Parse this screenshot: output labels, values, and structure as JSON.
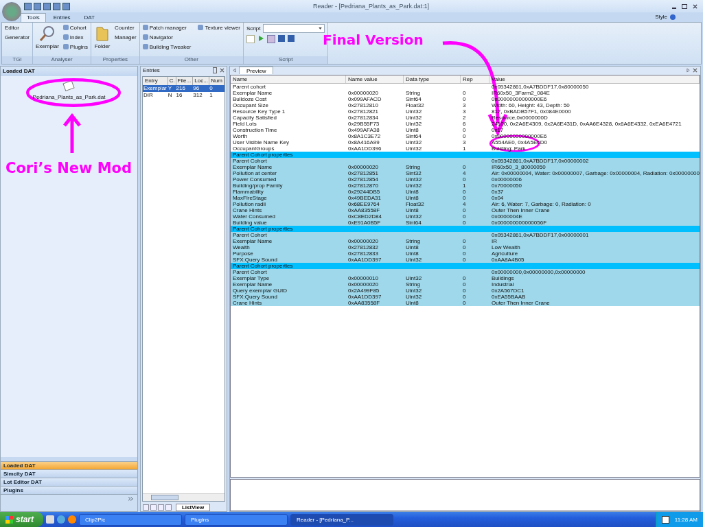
{
  "window": {
    "title": "Reader - [Pedriana_Plants_as_Park.dat:1]"
  },
  "ribbon": {
    "tabs": [
      {
        "label": "Tools",
        "selected": true
      },
      {
        "label": "Entries",
        "selected": false
      },
      {
        "label": "DAT",
        "selected": false
      }
    ],
    "style_menu": "Style",
    "groups": [
      {
        "label": "TGI",
        "items": [
          "Editor",
          "Generator"
        ]
      },
      {
        "label": "Analyser",
        "big": "Exemplar",
        "items": [
          "Cohort",
          "Index",
          "Plugins"
        ]
      },
      {
        "label": "Properties",
        "big": "Folder",
        "items": [
          "Counter",
          "Manager"
        ]
      },
      {
        "label": "Other",
        "items": [
          "Patch manager",
          "Navigator",
          "Building Tweaker",
          "Texture viewer"
        ]
      }
    ],
    "script": {
      "label": "Script",
      "group_label": "Script"
    }
  },
  "left_panel": {
    "title": "Loaded DAT",
    "file": "Pedriana_Plants_as_Park.dat",
    "nav": [
      {
        "label": "Loaded DAT",
        "selected": true
      },
      {
        "label": "Simcity DAT",
        "selected": false
      },
      {
        "label": "Lot Editor DAT",
        "selected": false
      },
      {
        "label": "Plugins",
        "selected": false
      }
    ]
  },
  "entries": {
    "title": "Entries",
    "columns": [
      "Entry",
      "C.",
      "File...",
      "Loc...",
      "Num"
    ],
    "rows": [
      {
        "cells": [
          "Exemplar",
          "Y",
          "216",
          "96",
          "0"
        ],
        "selected": true
      },
      {
        "cells": [
          "DIR",
          "N",
          "16",
          "312",
          "1"
        ],
        "selected": false
      }
    ],
    "tab": "ListView"
  },
  "preview": {
    "tab": "Preview",
    "columns": [
      "Name",
      "Name value",
      "Data type",
      "Rep",
      "Value"
    ],
    "groups": [
      {
        "highlighted": false,
        "rows": [
          [
            "Parent cohort",
            "",
            "",
            "",
            "0x05342861,0xA7BDDF17,0x80000050"
          ],
          [
            "Exemplar Name",
            "0x00000020",
            "String",
            "0",
            "IR60x50_3Farm2_084E"
          ],
          [
            "Bulldoze Cost",
            "0x099AFACD",
            "Sint64",
            "0",
            "0x00000000000000E6"
          ],
          [
            "Occupant Size",
            "0x27812810",
            "Float32",
            "3",
            "Width: 60, Height: 43, Depth: 50"
          ],
          [
            "Resource Key Type 1",
            "0x27812821",
            "Uint32",
            "3",
            "817, 0xBADB57F1, 0x084E0000"
          ],
          [
            "Capacity Satisfied",
            "0x27812834",
            "Uint32",
            "2",
            "Resource,0x0000000D"
          ],
          [
            "Field Lots",
            "0x29B55F73",
            "Uint32",
            "6",
            "24100, 0x2A6E4309, 0x2A6E431D, 0xAA6E4328, 0x6A6E4332, 0xEA6E4721"
          ],
          [
            "Construction Time",
            "0x499AFA38",
            "Uint8",
            "0",
            "0x17"
          ],
          [
            "Worth",
            "0x8A1C3E72",
            "Sint64",
            "0",
            "0x00000000000000E6"
          ],
          [
            "User Visible Name Key",
            "0x8A416A99",
            "Uint32",
            "3",
            "A554AE0, 0x4A5E6D0"
          ],
          [
            "OccupantGroups",
            "0xAA1DD396",
            "Uint32",
            "1",
            "Building: Park"
          ]
        ]
      },
      {
        "header": "Parent Cohort properties",
        "highlighted": true,
        "rows": [
          [
            "Parent Cohort",
            "",
            "",
            "",
            "0x05342861,0xA7BDDF17,0x00000002"
          ],
          [
            "Exemplar Name",
            "0x00000020",
            "String",
            "0",
            "IR60x50_3_80000050"
          ],
          [
            "Pollution at center",
            "0x27812851",
            "Sint32",
            "4",
            "Air: 0x00000004, Water: 0x00000007, Garbage: 0x00000004, Radiation: 0x00000000"
          ],
          [
            "Power Consumed",
            "0x27812854",
            "Uint32",
            "0",
            "0x00000006"
          ],
          [
            "Building/prop Family",
            "0x27812870",
            "Uint32",
            "1",
            "0x70000050"
          ],
          [
            "Flammability",
            "0x29244DB5",
            "Uint8",
            "0",
            "0x37"
          ],
          [
            "MaxFireStage",
            "0x49BEDA31",
            "Uint8",
            "0",
            "0x04"
          ],
          [
            "Pollution radii",
            "0x68EE9764",
            "Float32",
            "4",
            "Air: 6, Water: 7, Garbage: 0, Radiation: 0"
          ],
          [
            "Crane Hints",
            "0xAA83558F",
            "Uint8",
            "0",
            "Outer Then Inner Crane"
          ],
          [
            "Water Consumed",
            "0xC8ED2D84",
            "Uint32",
            "0",
            "0x0000004E"
          ],
          [
            "Building value",
            "0xE91A0B5F",
            "Sint64",
            "0",
            "0x000000000000056F"
          ]
        ]
      },
      {
        "header": "Parent Cohort properties",
        "highlighted": true,
        "rows": [
          [
            "Parent Cohort",
            "",
            "",
            "",
            "0x05342861,0xA7BDDF17,0x00000001"
          ],
          [
            "Exemplar Name",
            "0x00000020",
            "String",
            "0",
            "IR"
          ],
          [
            "Wealth",
            "0x27812832",
            "Uint8",
            "0",
            "Low Wealth"
          ],
          [
            "Purpose",
            "0x27812833",
            "Uint8",
            "0",
            "Agriculture"
          ],
          [
            "SFX:Query Sound",
            "0xAA1DD397",
            "Uint32",
            "0",
            "0xAA8A4B05"
          ]
        ]
      },
      {
        "header": "Parent Cohort properties",
        "highlighted": true,
        "rows": [
          [
            "Parent Cohort",
            "",
            "",
            "",
            "0x00000000,0x00000000,0x00000000"
          ],
          [
            "Exemplar Type",
            "0x00000010",
            "Uint32",
            "0",
            "Buildings"
          ],
          [
            "Exemplar Name",
            "0x00000020",
            "String",
            "0",
            "Industrial"
          ],
          [
            "Query exemplar GUID",
            "0x2A499F85",
            "Uint32",
            "0",
            "0x2A567DC1"
          ],
          [
            "SFX:Query Sound",
            "0xAA1DD397",
            "Uint32",
            "0",
            "0xEA55BAAB"
          ],
          [
            "Crane Hints",
            "0xAA83558F",
            "Uint8",
            "0",
            "Outer Then Inner Crane"
          ]
        ]
      }
    ]
  },
  "annotations": [
    {
      "text": "Final Version"
    },
    {
      "text": "Cori’s New Mod"
    }
  ],
  "taskbar": {
    "start": "start",
    "tasks": [
      {
        "label": "Clip2Pic",
        "selected": false
      },
      {
        "label": "Plugins",
        "selected": false
      },
      {
        "label": "Reader - [Pedriana_P...",
        "selected": true
      }
    ],
    "clock": "11:28 AM"
  }
}
